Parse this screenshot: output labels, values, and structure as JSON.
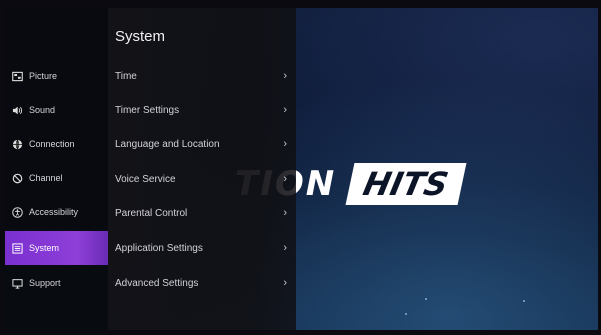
{
  "background": {
    "promo_word1": "TION",
    "promo_word2": "HITS"
  },
  "sidebar": {
    "items": [
      {
        "label": "Picture",
        "icon": "picture-icon"
      },
      {
        "label": "Sound",
        "icon": "sound-icon"
      },
      {
        "label": "Connection",
        "icon": "globe-icon"
      },
      {
        "label": "Channel",
        "icon": "satellite-icon"
      },
      {
        "label": "Accessibility",
        "icon": "accessibility-icon"
      },
      {
        "label": "System",
        "icon": "system-icon",
        "active": true
      },
      {
        "label": "Support",
        "icon": "support-icon"
      }
    ]
  },
  "panel": {
    "title": "System",
    "items": [
      {
        "label": "Time",
        "chevron": "›"
      },
      {
        "label": "Timer Settings",
        "chevron": "›"
      },
      {
        "label": "Language and Location",
        "chevron": "›"
      },
      {
        "label": "Voice Service",
        "chevron": "›"
      },
      {
        "label": "Parental Control",
        "chevron": "›"
      },
      {
        "label": "Application Settings",
        "chevron": "›"
      },
      {
        "label": "Advanced Settings",
        "chevron": "›"
      }
    ]
  },
  "colors": {
    "accent": "#8e3fd8",
    "sidebar_bg": "#08090e",
    "panel_bg": "#121216"
  }
}
